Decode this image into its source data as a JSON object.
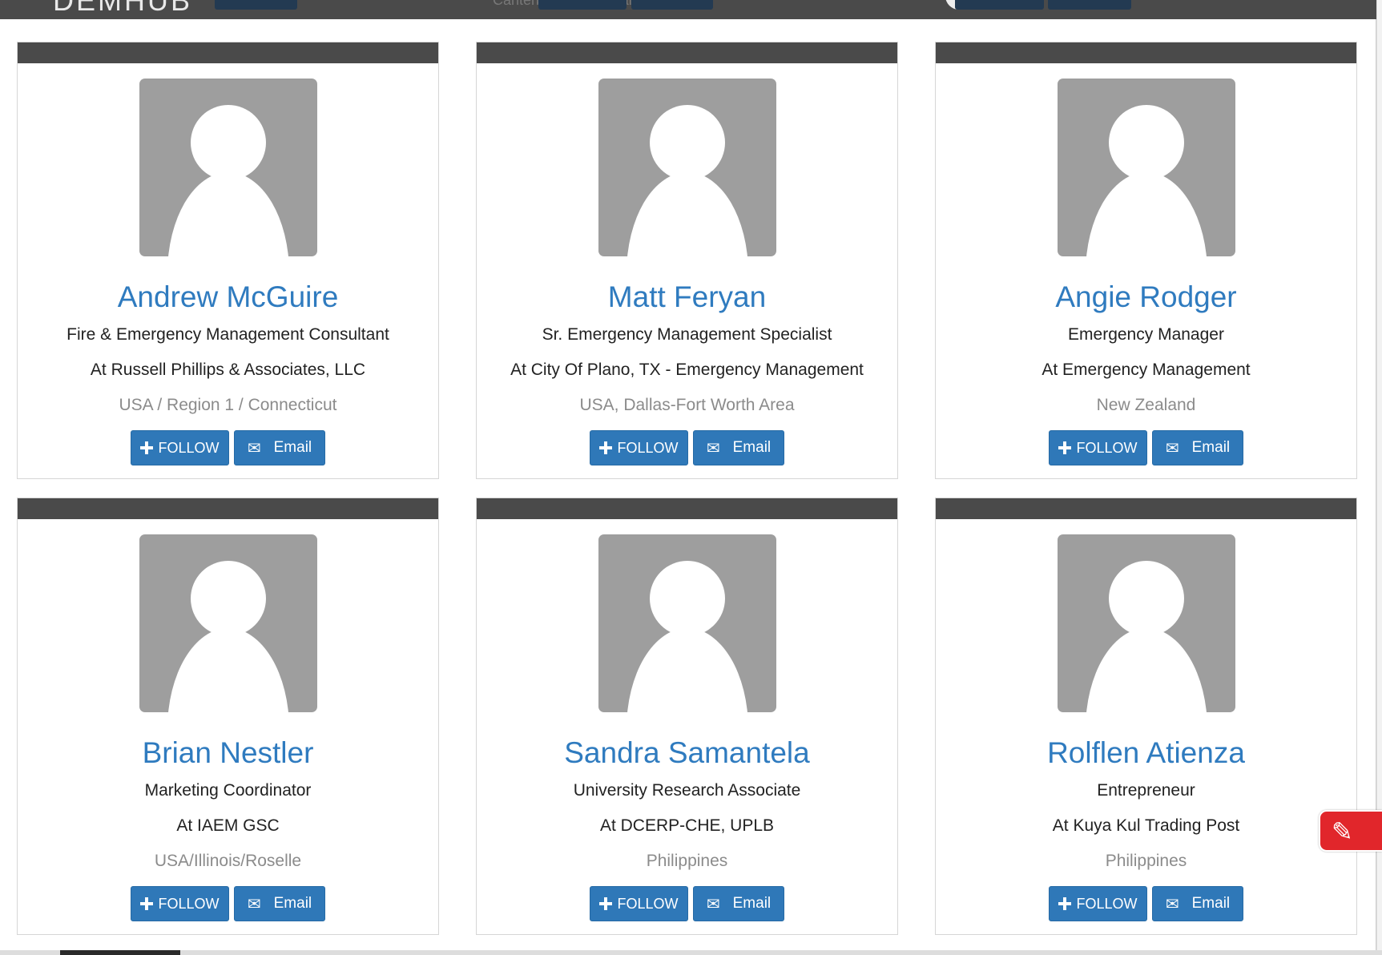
{
  "backdrop": {
    "logo_text": "DEMHUB",
    "ghost_text": "Canterbury, New Zealand"
  },
  "people": [
    {
      "name": "Andrew McGuire",
      "title": "Fire & Emergency Management Consultant",
      "company": "At Russell Phillips & Associates, LLC",
      "location": "USA / Region 1 / Connecticut",
      "follow_label": "FOLLOW",
      "email_label": "Email"
    },
    {
      "name": "Matt Feryan",
      "title": "Sr. Emergency Management Specialist",
      "company": "At City Of Plano, TX - Emergency Management",
      "location": "USA, Dallas-Fort Worth Area",
      "follow_label": "FOLLOW",
      "email_label": "Email"
    },
    {
      "name": "Angie Rodger",
      "title": "Emergency Manager",
      "company": "At Emergency Management",
      "location": "New Zealand",
      "follow_label": "FOLLOW",
      "email_label": "Email"
    },
    {
      "name": "Brian Nestler",
      "title": "Marketing Coordinator",
      "company": "At IAEM GSC",
      "location": "USA/Illinois/Roselle",
      "follow_label": "FOLLOW",
      "email_label": "Email"
    },
    {
      "name": "Sandra Samantela",
      "title": "University Research Associate",
      "company": "At DCERP-CHE, UPLB",
      "location": "Philippines",
      "follow_label": "FOLLOW",
      "email_label": "Email"
    },
    {
      "name": "Rolflen Atienza",
      "title": "Entrepreneur",
      "company": "At Kuya Kul Trading Post",
      "location": "Philippines",
      "follow_label": "FOLLOW",
      "email_label": "Email"
    }
  ],
  "icons": {
    "follow": "plus-icon",
    "email": "envelope-icon",
    "edit": "pencil-square-icon",
    "avatar": "default-avatar-icon"
  },
  "colors": {
    "name_link": "#2f7bbf",
    "button": "#2f78b8",
    "card_bar": "#4a4a4a",
    "location_text": "#8b8b8b",
    "edit_tab": "#e1262b"
  }
}
